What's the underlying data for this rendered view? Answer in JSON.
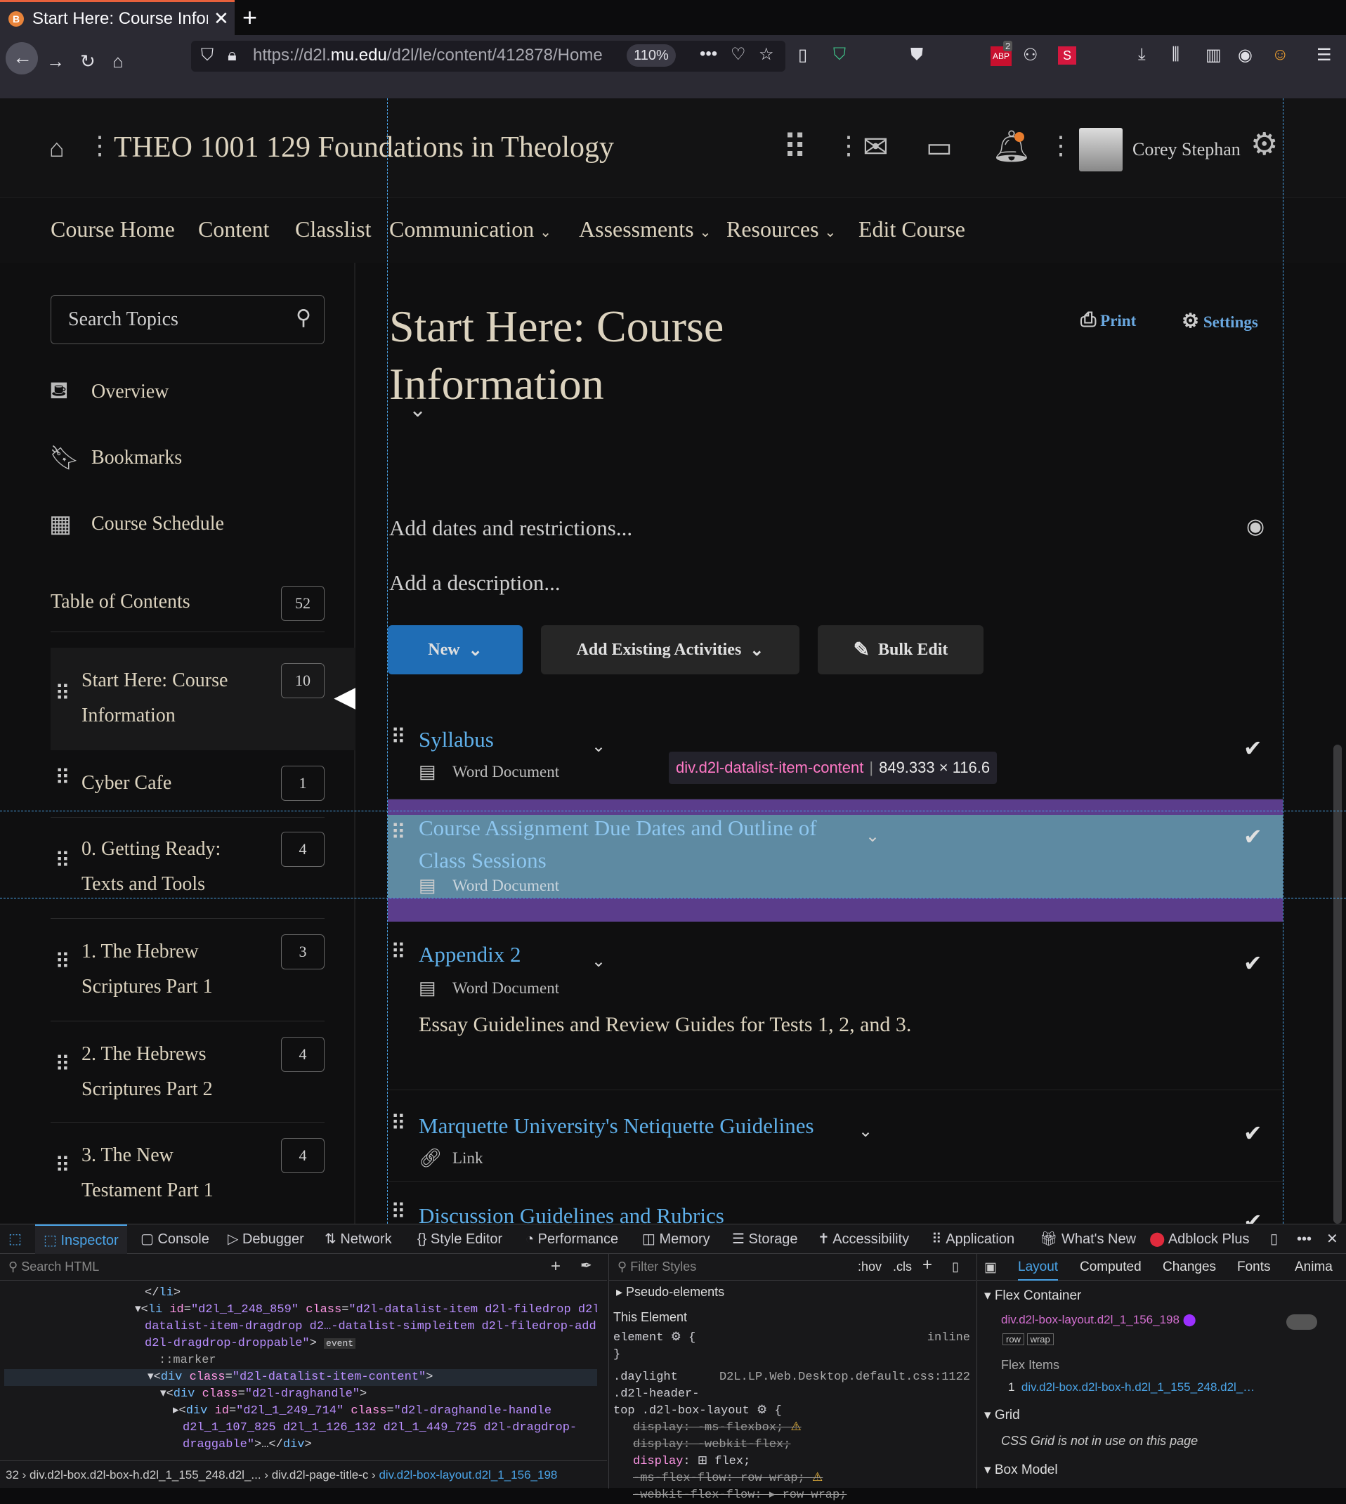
{
  "browser": {
    "tab_title": "Start Here: Course Inforn",
    "tab_favicon": "B",
    "url_prefix": "https://d2l.",
    "url_domain": "mu.edu",
    "url_path": "/d2l/le/content/412878/Home",
    "zoom": "110%",
    "abp_count": "2"
  },
  "header": {
    "course_title": "THEO 1001 129 Foundations in Theology",
    "user_name": "Corey Stephan"
  },
  "topnav": [
    "Course Home",
    "Content",
    "Classlist",
    "Communication",
    "Assessments",
    "Resources",
    "Edit Course"
  ],
  "sidebar": {
    "search_placeholder": "Search Topics",
    "items": [
      "Overview",
      "Bookmarks",
      "Course Schedule"
    ],
    "toc_label": "Table of Contents",
    "toc_count": "52",
    "modules": [
      {
        "l1": "Start Here: Course",
        "l2": "Information",
        "count": "10"
      },
      {
        "l1": "Cyber Cafe",
        "l2": "",
        "count": "1"
      },
      {
        "l1": "0. Getting Ready:",
        "l2": "Texts and Tools",
        "count": "4"
      },
      {
        "l1": "1. The Hebrew",
        "l2": "Scriptures Part 1",
        "count": "3"
      },
      {
        "l1": "2. The Hebrews",
        "l2": "Scriptures Part 2",
        "count": "4"
      },
      {
        "l1": "3. The New",
        "l2": "Testament Part 1",
        "count": "4"
      }
    ]
  },
  "main": {
    "title_l1": "Start Here: Course",
    "title_l2": "Information",
    "print": "Print",
    "settings": "Settings",
    "dates_ph": "Add dates and restrictions...",
    "desc_ph": "Add a description...",
    "btn_new": "New",
    "btn_existing": "Add Existing Activities",
    "btn_bulk": "Bulk Edit",
    "items": [
      {
        "title": "Syllabus",
        "type": "Word Document"
      },
      {
        "title_l1": "Course Assignment Due Dates and Outline of",
        "title_l2": "Class Sessions",
        "type": "Word Document"
      },
      {
        "title": "Appendix 2",
        "type": "Word Document",
        "desc": "Essay Guidelines and Review Guides for Tests 1, 2, and 3."
      },
      {
        "title": "Marquette University's Netiquette Guidelines",
        "type": "Link"
      },
      {
        "title": "Discussion Guidelines and Rubrics"
      }
    ],
    "tooltip_sel": "div.d2l-datalist-item-content",
    "tooltip_size": "849.333 × 116.6"
  },
  "devtools": {
    "tabs": [
      "Inspector",
      "Console",
      "Debugger",
      "Network",
      "Style Editor",
      "Performance",
      "Memory",
      "Storage",
      "Accessibility",
      "Application",
      "What's New",
      "Adblock Plus"
    ],
    "search_html": "Search HTML",
    "filter_styles": "Filter Styles",
    "hov": ":hov",
    "cls": ".cls",
    "layout_tabs": [
      "Layout",
      "Computed",
      "Changes",
      "Fonts",
      "Anima"
    ],
    "pseudo": "Pseudo-elements",
    "this_element": "This Element",
    "flex_container": "Flex Container",
    "flex_container_sel": "div.d2l-box-layout.d2l_1_156_198",
    "flex_row": "row",
    "flex_wrap": "wrap",
    "flex_items": "Flex Items",
    "flex_item_num": "1",
    "flex_item_sel": "div.d2l-box.d2l-box-h.d2l_1_155_248.d2l_…",
    "grid": "Grid",
    "grid_msg": "CSS Grid is not in use on this page",
    "box_model": "Box Model",
    "rule_source": "D2L.LP.Web.Desktop.default.css:1122",
    "crumbs": [
      "32",
      "div.d2l-box.d2l-box-h.d2l_1_155_248.d2l_...",
      "div.d2l-page-title-c",
      "div.d2l-box-layout.d2l_1_156_198"
    ]
  }
}
